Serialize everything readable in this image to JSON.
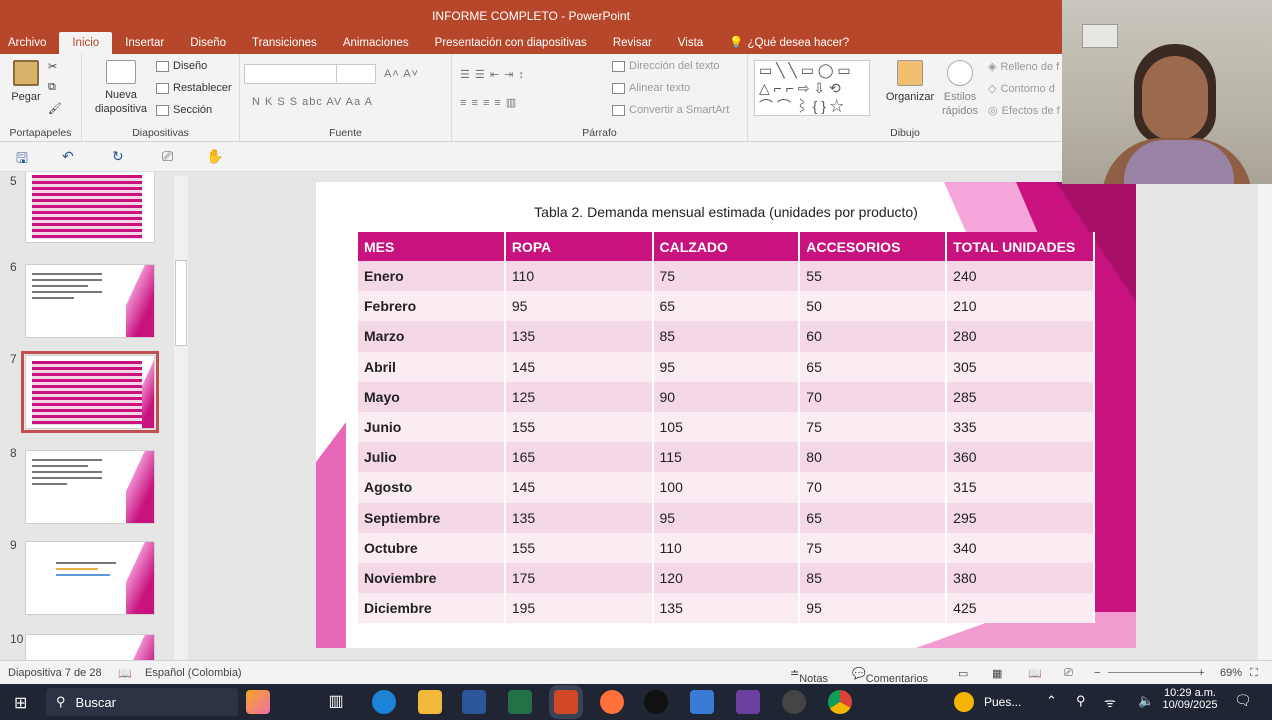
{
  "window": {
    "title": "INFORME COMPLETO - PowerPoint"
  },
  "ribbon_tabs": [
    "Archivo",
    "Inicio",
    "Insertar",
    "Diseño",
    "Transiciones",
    "Animaciones",
    "Presentación con diapositivas",
    "Revisar",
    "Vista"
  ],
  "tell_me": "¿Qué desea hacer?",
  "ribbon": {
    "paste": "Pegar",
    "new_slide_1": "Nueva",
    "new_slide_2": "diapositiva",
    "layout": "Diseño",
    "reset": "Restablecer",
    "section": "Sección",
    "text_direction": "Dirección del texto",
    "align_text": "Alinear texto",
    "smartart": "Convertir a SmartArt",
    "arrange": "Organizar",
    "quick_styles_1": "Estilos",
    "quick_styles_2": "rápidos",
    "shape_fill": "Relleno de f",
    "shape_outline": "Contorno d",
    "shape_effects": "Efectos de f",
    "groups": {
      "clipboard": "Portapapeles",
      "slides": "Diapositivas",
      "font": "Fuente",
      "paragraph": "Párrafo",
      "drawing": "Dibujo"
    }
  },
  "thumbnails": {
    "numbers": [
      "5",
      "6",
      "7",
      "8",
      "9",
      "10"
    ]
  },
  "slide": {
    "title": "Tabla 2. Demanda mensual estimada (unidades por producto)",
    "headers": [
      "MES",
      "ROPA",
      "CALZADO",
      "ACCESORIOS",
      "TOTAL UNIDADES"
    ],
    "rows": [
      [
        "Enero",
        "110",
        "75",
        "55",
        "240"
      ],
      [
        "Febrero",
        "95",
        "65",
        "50",
        "210"
      ],
      [
        "Marzo",
        "135",
        "85",
        "60",
        "280"
      ],
      [
        "Abril",
        "145",
        "95",
        "65",
        "305"
      ],
      [
        "Mayo",
        "125",
        "90",
        "70",
        "285"
      ],
      [
        "Junio",
        "155",
        "105",
        "75",
        "335"
      ],
      [
        "Julio",
        "165",
        "115",
        "80",
        "360"
      ],
      [
        "Agosto",
        "145",
        "100",
        "70",
        "315"
      ],
      [
        "Septiembre",
        "135",
        "95",
        "65",
        "295"
      ],
      [
        "Octubre",
        "155",
        "110",
        "75",
        "340"
      ],
      [
        "Noviembre",
        "175",
        "120",
        "85",
        "380"
      ],
      [
        "Diciembre",
        "195",
        "135",
        "95",
        "425"
      ]
    ]
  },
  "status": {
    "slide_info": "Diapositiva 7 de 28",
    "language": "Español (Colombia)",
    "notes": "Notas",
    "comments": "Comentarios",
    "zoom": "69%"
  },
  "taskbar": {
    "search": "Buscar",
    "weather": "Pues...",
    "time": "10:29 a.m.",
    "date": "10/09/2025"
  },
  "colors": {
    "accent": "#b7472a",
    "table_header": "#c8137e",
    "row_odd": "#f4d8e6",
    "row_even": "#fbecf3"
  }
}
